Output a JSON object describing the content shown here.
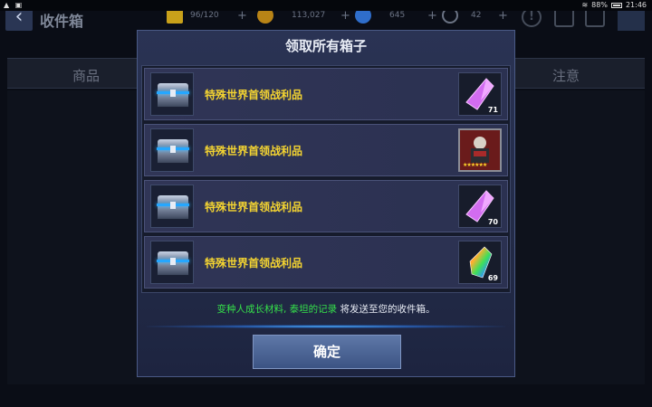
{
  "statusbar": {
    "left": "▲ ▣",
    "battery": "88%",
    "time": "21:46"
  },
  "topbar": {
    "back_icon": "‹",
    "title": "收件箱",
    "energy": "96/120",
    "gold": "113,027",
    "crystal": "645",
    "timer": "42",
    "alert_icon": "!"
  },
  "bg_tabs": {
    "left": "商品",
    "right": "注意"
  },
  "modal": {
    "title": "领取所有箱子",
    "rows": [
      {
        "label": "特殊世界首领战利品",
        "reward": "purple-crystal",
        "count": "71"
      },
      {
        "label": "特殊世界首领战利品",
        "reward": "character-card",
        "count": ""
      },
      {
        "label": "特殊世界首领战利品",
        "reward": "purple-crystal",
        "count": "70"
      },
      {
        "label": "特殊世界首领战利品",
        "reward": "rainbow-crystal",
        "count": "69"
      }
    ],
    "message": {
      "part1": "变种人成长材料, 泰坦的记录",
      "part2": " 将发送至您的收件箱。"
    },
    "confirm": "确定"
  },
  "colors": {
    "label_yellow": "#f4d431",
    "highlight_green": "#35e04a",
    "accent_blue": "#25a7ff"
  }
}
